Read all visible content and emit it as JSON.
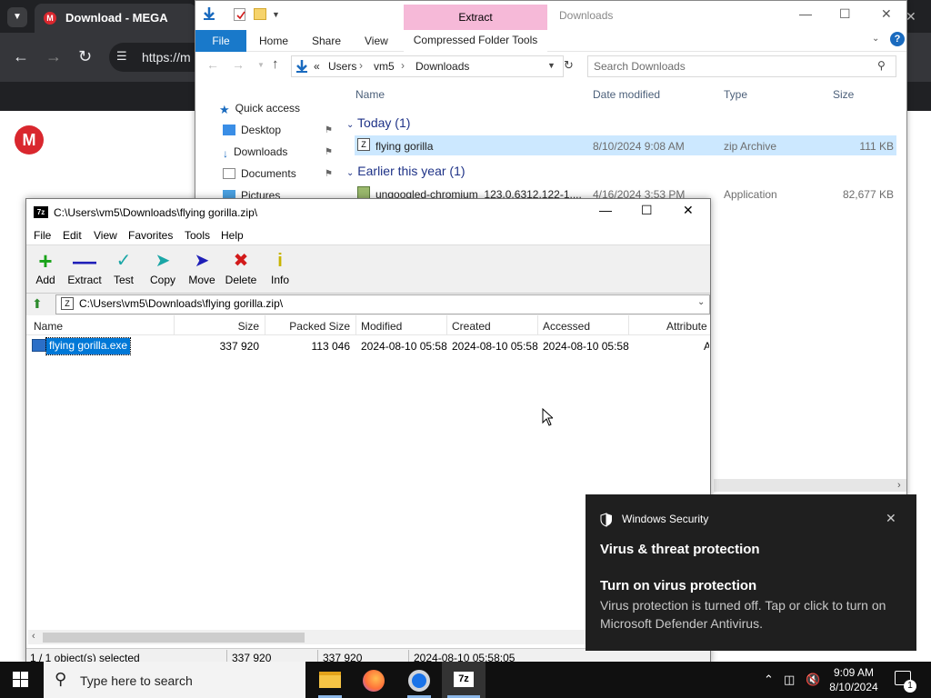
{
  "chrome": {
    "tab_title": "Download - MEGA",
    "url_text": "https://m",
    "logo_letter": "M"
  },
  "explorer": {
    "title": "Downloads",
    "contextual_tab": "Extract",
    "ribbon_tabs": [
      "File",
      "Home",
      "Share",
      "View",
      "Compressed Folder Tools"
    ],
    "breadcrumb": [
      "Users",
      "vm5",
      "Downloads"
    ],
    "breadcrumb_prefix": "«",
    "search_placeholder": "Search Downloads",
    "columns": [
      "Name",
      "Date modified",
      "Type",
      "Size"
    ],
    "nav": [
      {
        "label": "Quick access",
        "icon": "star-icon"
      },
      {
        "label": "Desktop",
        "icon": "desktop-icon"
      },
      {
        "label": "Downloads",
        "icon": "download-icon"
      },
      {
        "label": "Documents",
        "icon": "document-icon"
      },
      {
        "label": "Pictures",
        "icon": "pictures-icon"
      }
    ],
    "groups": [
      {
        "label": "Today (1)"
      },
      {
        "label": "Earlier this year (1)"
      }
    ],
    "files": [
      {
        "name": "flying gorilla",
        "date": "8/10/2024 9:08 AM",
        "type": "zip Archive",
        "size": "111 KB"
      },
      {
        "name": "ungoogled-chromium_123.0.6312.122-1....",
        "date": "4/16/2024 3:53 PM",
        "type": "Application",
        "size": "82,677 KB"
      }
    ]
  },
  "sevenzip": {
    "title": "C:\\Users\\vm5\\Downloads\\flying gorilla.zip\\",
    "menu": [
      "File",
      "Edit",
      "View",
      "Favorites",
      "Tools",
      "Help"
    ],
    "toolbar": [
      {
        "label": "Add",
        "icon": "add-icon",
        "color": "#19a319"
      },
      {
        "label": "Extract",
        "icon": "extract-icon",
        "color": "#1f1fb8"
      },
      {
        "label": "Test",
        "icon": "test-icon",
        "color": "#1aa6a6"
      },
      {
        "label": "Copy",
        "icon": "copy-icon",
        "color": "#1aa6a6"
      },
      {
        "label": "Move",
        "icon": "move-icon",
        "color": "#1f1fb8"
      },
      {
        "label": "Delete",
        "icon": "delete-icon",
        "color": "#d21a1a"
      },
      {
        "label": "Info",
        "icon": "info-icon",
        "color": "#c8b400"
      }
    ],
    "path": "C:\\Users\\vm5\\Downloads\\flying gorilla.zip\\",
    "columns": [
      "Name",
      "Size",
      "Packed Size",
      "Modified",
      "Created",
      "Accessed",
      "Attribute"
    ],
    "row": {
      "name": "flying gorilla.exe",
      "size": "337 920",
      "packed": "113 046",
      "modified": "2024-08-10 05:58",
      "created": "2024-08-10 05:58",
      "accessed": "2024-08-10 05:58",
      "attr": "A"
    },
    "status": {
      "selected": "1 / 1 object(s) selected",
      "size": "337 920",
      "packed": "337 920",
      "date": "2024-08-10 05:58:05"
    }
  },
  "toast": {
    "app": "Windows Security",
    "heading": "Virus & threat protection",
    "subheading": "Turn on virus protection",
    "body": "Virus protection is turned off. Tap or click to turn on Microsoft Defender Antivirus."
  },
  "taskbar": {
    "search_placeholder": "Type here to search",
    "time": "9:09 AM",
    "date": "8/10/2024",
    "notification_count": "1"
  }
}
